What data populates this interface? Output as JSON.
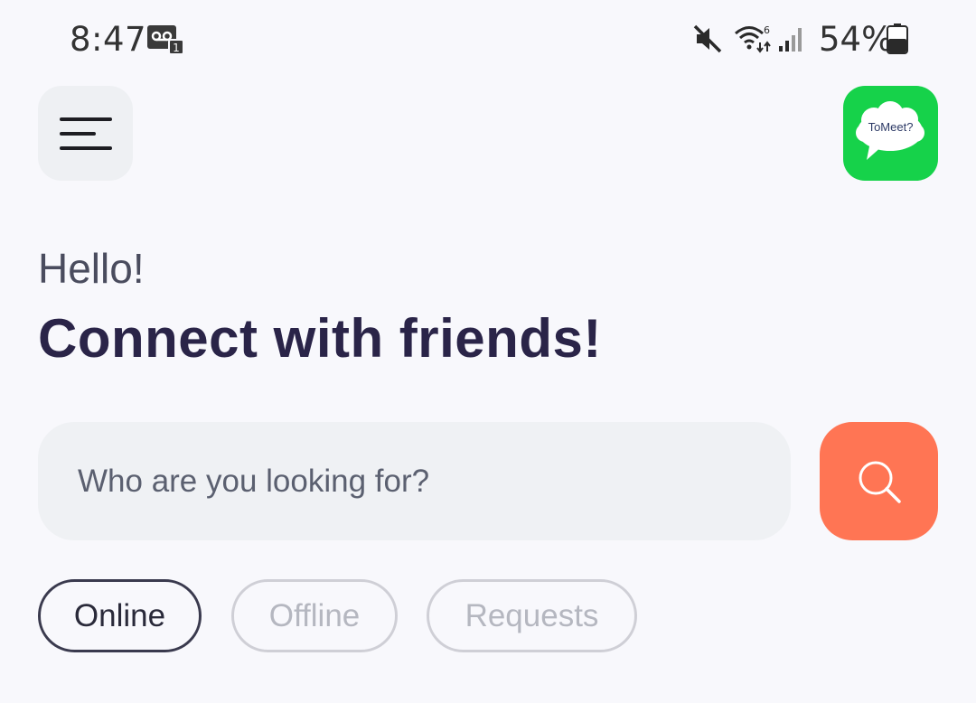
{
  "status_bar": {
    "time": "8:47",
    "battery": "54%",
    "icons": [
      "voicemail-icon",
      "mute-icon",
      "wifi-icon",
      "signal-icon",
      "battery-icon"
    ]
  },
  "header": {
    "menu_icon": "hamburger-menu-icon",
    "logo_text": "ToMeet?"
  },
  "greeting": {
    "hello": "Hello!",
    "headline": "Connect with friends!"
  },
  "search": {
    "placeholder": "Who are you looking for?",
    "button_icon": "search-icon"
  },
  "tabs": [
    {
      "label": "Online",
      "active": true
    },
    {
      "label": "Offline",
      "active": false
    },
    {
      "label": "Requests",
      "active": false
    }
  ],
  "colors": {
    "background": "#f8f8fc",
    "accent": "#ff7554",
    "logo_green": "#16d24a",
    "headline": "#2a2448"
  }
}
